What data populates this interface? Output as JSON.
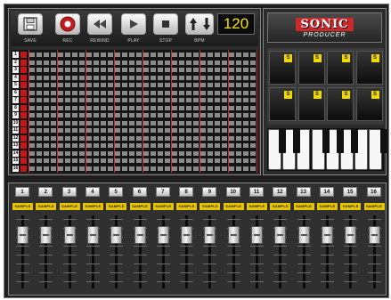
{
  "toolbar": {
    "buttons": [
      {
        "id": "save",
        "label": "SAVE",
        "icon": "floppy-disk-icon"
      },
      {
        "id": "rec",
        "label": "REC",
        "icon": "record-icon"
      },
      {
        "id": "rewind",
        "label": "REWIND",
        "icon": "rewind-icon"
      },
      {
        "id": "play",
        "label": "PLAY",
        "icon": "play-icon"
      },
      {
        "id": "stop",
        "label": "STOP",
        "icon": "stop-icon"
      }
    ],
    "bpm": {
      "label": "BPM",
      "value": "120",
      "up_icon": "arrow-up-icon",
      "down_icon": "arrow-down-icon"
    }
  },
  "sequencer": {
    "rows": [
      "1",
      "2",
      "3",
      "4",
      "5",
      "6",
      "7",
      "8",
      "9",
      "10",
      "11",
      "12",
      "13",
      "14",
      "15",
      "16"
    ],
    "steps": 32
  },
  "logo": {
    "line1": "SONIC",
    "line2": "PRODUCER"
  },
  "pads": {
    "badge": "S",
    "count": 8
  },
  "keyboard": {
    "white_keys": 8
  },
  "mixer": {
    "channels": [
      {
        "number": "1",
        "sample": "SAMPLE",
        "level": 0.8
      },
      {
        "number": "2",
        "sample": "SAMPLE",
        "level": 0.8
      },
      {
        "number": "3",
        "sample": "SAMPLE",
        "level": 0.8
      },
      {
        "number": "4",
        "sample": "SAMPLE",
        "level": 0.8
      },
      {
        "number": "5",
        "sample": "SAMPLE",
        "level": 0.8
      },
      {
        "number": "6",
        "sample": "SAMPLE",
        "level": 0.8
      },
      {
        "number": "7",
        "sample": "SAMPLE",
        "level": 0.8
      },
      {
        "number": "8",
        "sample": "SAMPLE",
        "level": 0.8
      },
      {
        "number": "9",
        "sample": "SAMPLE",
        "level": 0.8
      },
      {
        "number": "10",
        "sample": "SAMPLE",
        "level": 0.8
      },
      {
        "number": "11",
        "sample": "SAMPLE",
        "level": 0.8
      },
      {
        "number": "12",
        "sample": "SAMPLE",
        "level": 0.8
      },
      {
        "number": "13",
        "sample": "SAMPLE",
        "level": 0.8
      },
      {
        "number": "14",
        "sample": "SAMPLE",
        "level": 0.8
      },
      {
        "number": "15",
        "sample": "SAMPLE",
        "level": 0.8
      },
      {
        "number": "16",
        "sample": "SAMPLE",
        "level": 0.8
      }
    ]
  },
  "colors": {
    "accent_yellow": "#f2d800",
    "record_red": "#cc2a2a",
    "bpm_text": "#f4e200",
    "panel_bg": "#2b2b2b"
  }
}
